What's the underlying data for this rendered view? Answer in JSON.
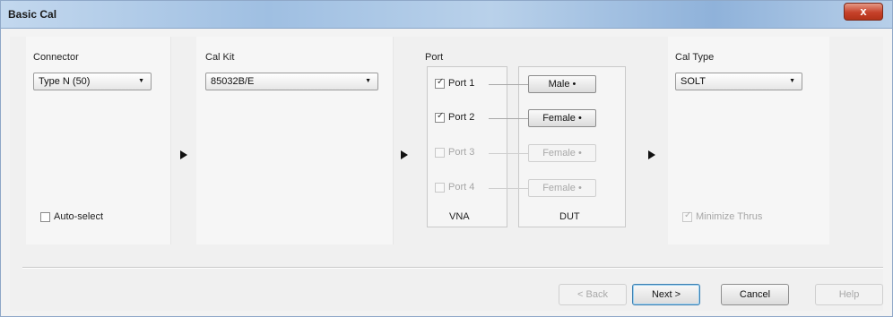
{
  "window": {
    "title": "Basic Cal",
    "close_glyph": "x"
  },
  "connector": {
    "label": "Connector",
    "value": "Type N (50)",
    "auto_select_label": "Auto-select",
    "auto_select_checked": false
  },
  "cal_kit": {
    "label": "Cal Kit",
    "value": "85032B/E"
  },
  "port": {
    "label": "Port",
    "vna_label": "VNA",
    "dut_label": "DUT",
    "rows": [
      {
        "name": "Port 1",
        "checked": true,
        "enabled": true,
        "dut_value": "Male •"
      },
      {
        "name": "Port 2",
        "checked": true,
        "enabled": true,
        "dut_value": "Female •"
      },
      {
        "name": "Port 3",
        "checked": false,
        "enabled": false,
        "dut_value": "Female •"
      },
      {
        "name": "Port 4",
        "checked": false,
        "enabled": false,
        "dut_value": "Female •"
      }
    ]
  },
  "cal_type": {
    "label": "Cal Type",
    "value": "SOLT",
    "minimize_thrus_label": "Minimize Thrus",
    "minimize_thrus_checked": true
  },
  "footer": {
    "back": "< Back",
    "next": "Next >",
    "cancel": "Cancel",
    "help": "Help"
  },
  "icons": {
    "combo_arrow": "triangle-down-icon",
    "flow_arrow": "triangle-right-icon",
    "close": "close-icon"
  }
}
